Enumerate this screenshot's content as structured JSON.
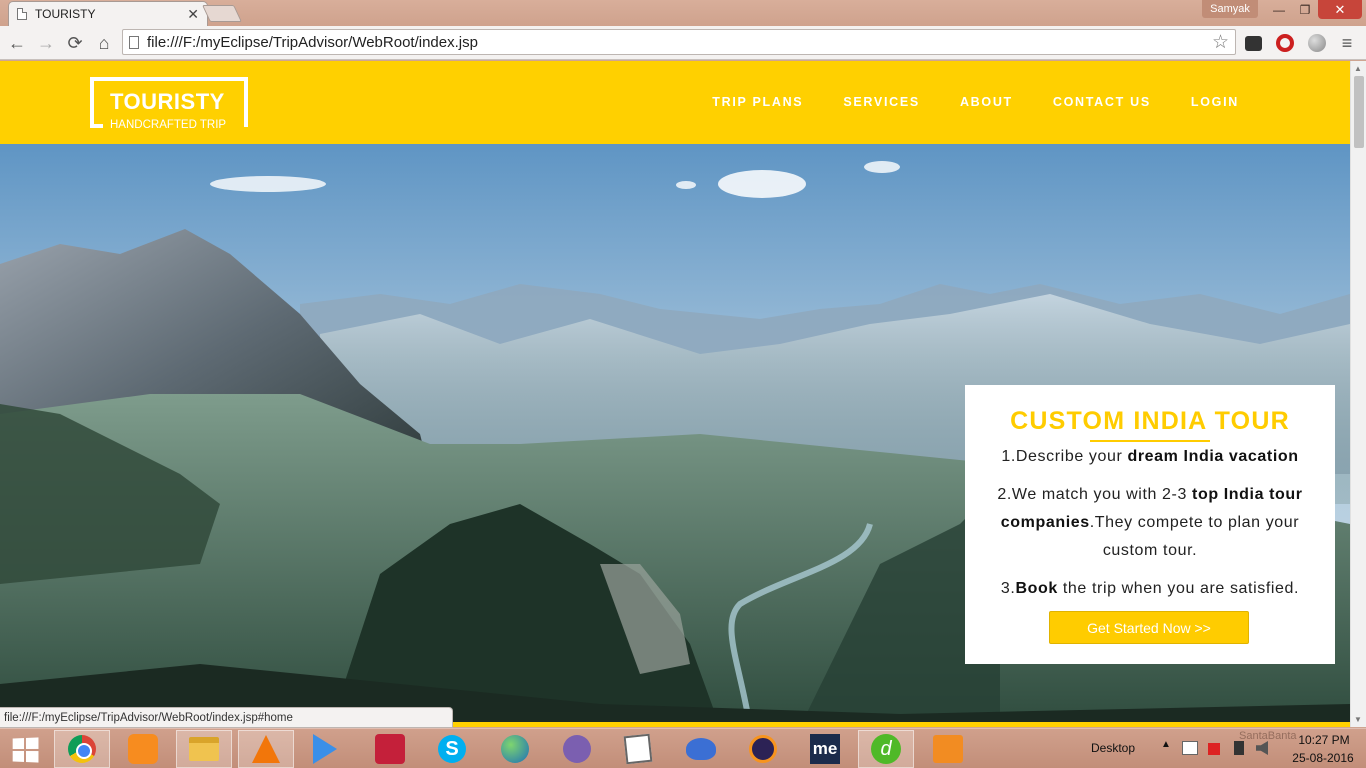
{
  "browser": {
    "tab_title": "TOURISTY",
    "tab_close": "✕",
    "user_name": "Samyak",
    "url": "file:///F:/myEclipse/TripAdvisor/WebRoot/index.jsp",
    "status_url": "file:///F:/myEclipse/TripAdvisor/WebRoot/index.jsp#home",
    "controls": {
      "back": "←",
      "forward": "→",
      "reload": "⟳",
      "home": "⌂",
      "star": "☆",
      "menu": "≡",
      "minimize": "—",
      "maximize": "❐",
      "close": "✕"
    }
  },
  "site": {
    "logo_title": "TOURISTY",
    "logo_subtitle": "HANDCRAFTED TRIP",
    "nav": [
      "TRIP PLANS",
      "SERVICES",
      "ABOUT",
      "CONTACT US",
      "LOGIN"
    ],
    "accent_color": "#ffd000",
    "promo": {
      "title": "CUSTOM INDIA TOUR",
      "step1_prefix": "1.Describe your ",
      "step1_bold": "dream India vacation",
      "step2_prefix": "2.We match you with 2-3 ",
      "step2_bold": "top India tour companies",
      "step2_suffix": ".They compete to plan your custom tour.",
      "step3_prefix": "3.",
      "step3_bold": "Book",
      "step3_suffix": " the trip when you are satisfied.",
      "cta": "Get Started Now  >>"
    }
  },
  "taskbar": {
    "apps": [
      "chrome-icon",
      "uc-browser-icon",
      "file-explorer-icon",
      "vlc-icon",
      "media-player-icon",
      "screen-recorder-icon",
      "skype-icon",
      "network-globe-icon",
      "tor-icon",
      "notepad-icon",
      "dolphin-icon",
      "eclipse-icon",
      "me-icon",
      "dreamweaver-icon",
      "security-lock-icon"
    ],
    "desktop_label": "Desktop",
    "tray_up": "▲",
    "watermark": "SantaBanta",
    "time": "10:27 PM",
    "date": "25-08-2016"
  }
}
